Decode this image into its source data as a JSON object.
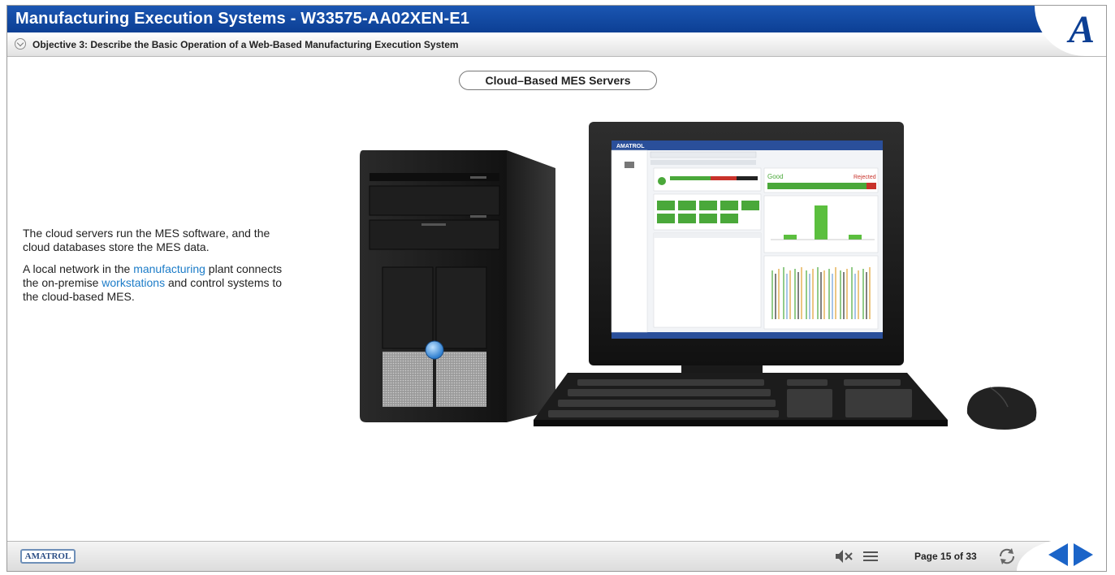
{
  "header": {
    "title": "Manufacturing Execution Systems - W33575-AA02XEN-E1",
    "objective": "Objective 3: Describe the Basic Operation of a Web-Based Manufacturing Execution System",
    "logo_letter": "A"
  },
  "content": {
    "subtitle": "Cloud–Based MES Servers",
    "para1": "The cloud servers run the MES software, and the cloud databases store the MES data.",
    "para2_a": "A local network in the ",
    "para2_link1": "manufacturing",
    "para2_b": " plant connects the on-premise ",
    "para2_link2": "workstations",
    "para2_c": " and control systems to the cloud-based MES."
  },
  "screen": {
    "brand": "AMATROL",
    "status_good": "Good",
    "status_rejected": "Rejected"
  },
  "footer": {
    "logo_text": "AMATROL",
    "page_label": "Page 15 of 33"
  },
  "colors": {
    "title_blue": "#0c3f94",
    "link_blue": "#1c7cc8",
    "nav_blue": "#1b64c8",
    "screen_green": "#4aa83a",
    "screen_red": "#c8322a"
  },
  "icons": {
    "mute": "speaker-muted-icon",
    "menu": "menu-icon",
    "refresh": "refresh-icon",
    "prev": "arrow-left-icon",
    "next": "arrow-right-icon",
    "collapse": "chevron-down-icon"
  }
}
